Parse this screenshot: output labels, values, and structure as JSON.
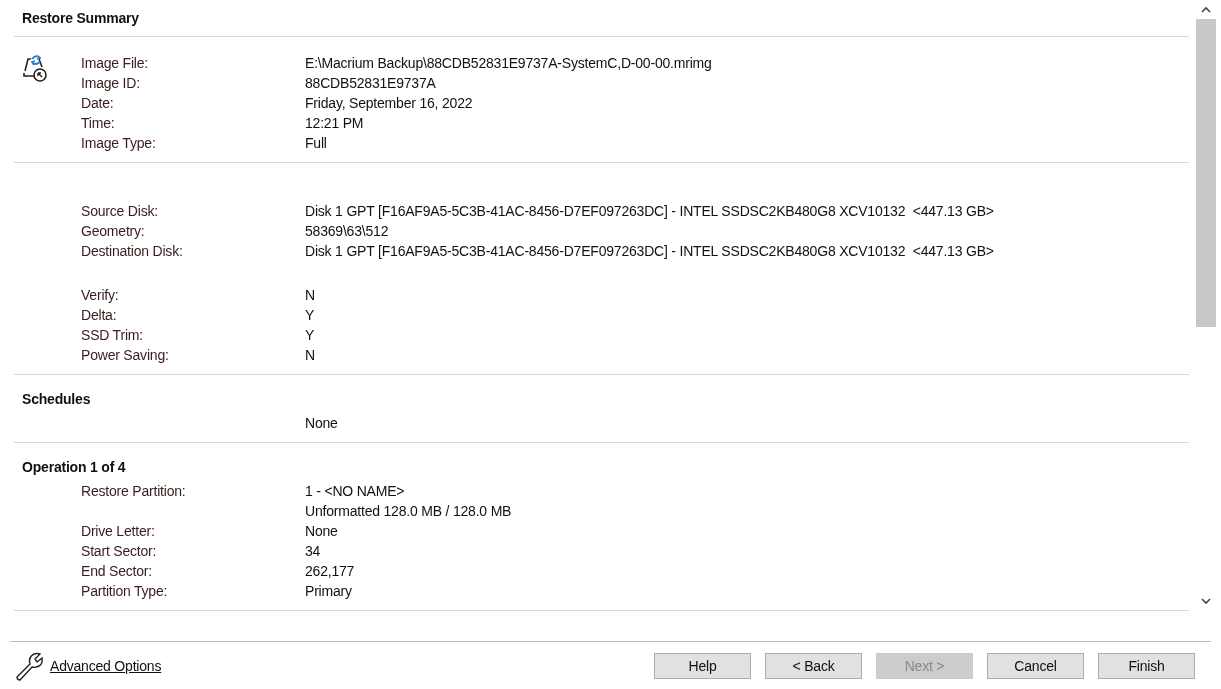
{
  "title": "Restore Summary",
  "groups": [
    {
      "show_icon": true,
      "blocks": [
        [
          {
            "label": "Image File:",
            "values": [
              "E:\\Macrium Backup\\88CDB52831E9737A-SystemC,D-00-00.mrimg"
            ]
          },
          {
            "label": "Image ID:",
            "values": [
              "88CDB52831E9737A"
            ]
          },
          {
            "label": "Date:",
            "values": [
              "Friday, September 16, 2022"
            ]
          },
          {
            "label": "Time:",
            "values": [
              "12:21 PM"
            ]
          },
          {
            "label": "Image Type:",
            "values": [
              "Full"
            ]
          }
        ]
      ]
    },
    {
      "show_icon": false,
      "blocks": [
        [
          {
            "label": "Source Disk:",
            "values": [
              "Disk 1 GPT [F16AF9A5-5C3B-41AC-8456-D7EF097263DC] - INTEL SSDSC2KB480G8 XCV10132  <447.13 GB>"
            ]
          },
          {
            "label": "Geometry:",
            "values": [
              "58369\\63\\512"
            ]
          },
          {
            "label": "Destination Disk:",
            "values": [
              "Disk 1 GPT [F16AF9A5-5C3B-41AC-8456-D7EF097263DC] - INTEL SSDSC2KB480G8 XCV10132  <447.13 GB>"
            ]
          }
        ],
        [
          {
            "label": "Verify:",
            "values": [
              "N"
            ]
          },
          {
            "label": "Delta:",
            "values": [
              "Y"
            ]
          },
          {
            "label": "SSD Trim:",
            "values": [
              "Y"
            ]
          },
          {
            "label": "Power Saving:",
            "values": [
              "N"
            ]
          }
        ]
      ]
    },
    {
      "heading": "Schedules",
      "show_icon": false,
      "blocks": [
        [
          {
            "values": [
              "None"
            ]
          }
        ]
      ]
    },
    {
      "heading": "Operation 1 of 4",
      "show_icon": false,
      "blocks": [
        [
          {
            "label": "Restore Partition:",
            "values": [
              "1 - <NO NAME>",
              "Unformatted 128.0 MB / 128.0 MB"
            ]
          },
          {
            "label": "Drive Letter:",
            "values": [
              "None"
            ]
          },
          {
            "label": "Start Sector:",
            "values": [
              "34"
            ]
          },
          {
            "label": "End Sector:",
            "values": [
              "262,177"
            ]
          },
          {
            "label": "Partition Type:",
            "values": [
              "Primary"
            ]
          }
        ]
      ]
    }
  ],
  "advanced_link": "Advanced Options",
  "buttons": [
    {
      "label": "Help",
      "disabled": false
    },
    {
      "label": "< Back",
      "disabled": false
    },
    {
      "label": "Next >",
      "disabled": true
    },
    {
      "label": "Cancel",
      "disabled": false
    },
    {
      "label": "Finish",
      "disabled": false
    }
  ]
}
